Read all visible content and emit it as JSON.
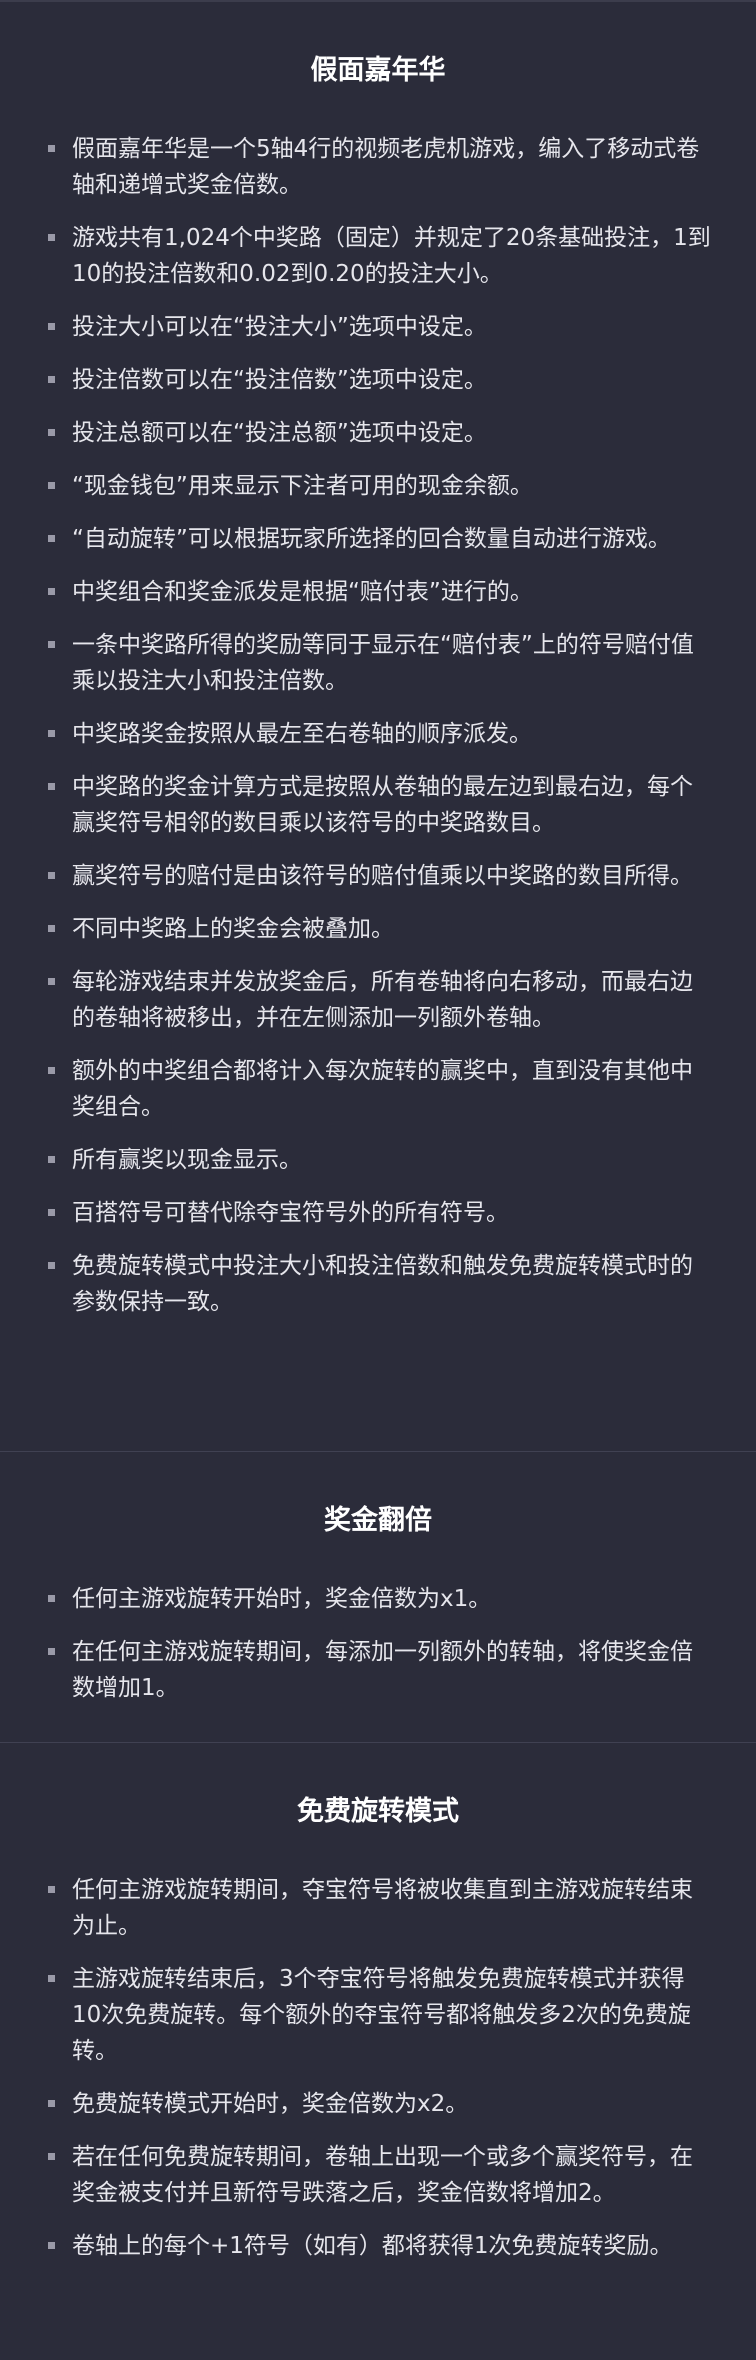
{
  "sections": [
    {
      "title": "假面嘉年华",
      "items": [
        "假面嘉年华是一个5轴4行的视频老虎机游戏，编入了移动式卷轴和递增式奖金倍数。",
        "游戏共有1,024个中奖路（固定）并规定了20条基础投注，1到10的投注倍数和0.02到0.20的投注大小。",
        "投注大小可以在“投注大小”选项中设定。",
        "投注倍数可以在“投注倍数”选项中设定。",
        "投注总额可以在“投注总额”选项中设定。",
        "“现金钱包”用来显示下注者可用的现金余额。",
        "“自动旋转”可以根据玩家所选择的回合数量自动进行游戏。",
        "中奖组合和奖金派发是根据“赔付表”进行的。",
        "一条中奖路所得的奖励等同于显示在“赔付表”上的符号赔付值乘以投注大小和投注倍数。",
        "中奖路奖金按照从最左至右卷轴的顺序派发。",
        "中奖路的奖金计算方式是按照从卷轴的最左边到最右边，每个赢奖符号相邻的数目乘以该符号的中奖路数目。",
        "赢奖符号的赔付是由该符号的赔付值乘以中奖路的数目所得。",
        "不同中奖路上的奖金会被叠加。",
        "每轮游戏结束并发放奖金后，所有卷轴将向右移动，而最右边的卷轴将被移出，并在左侧添加一列额外卷轴。",
        "额外的中奖组合都将计入每次旋转的赢奖中，直到没有其他中奖组合。",
        "所有赢奖以现金显示。",
        "百搭符号可替代除夺宝符号外的所有符号。",
        "免费旋转模式中投注大小和投注倍数和触发免费旋转模式时的参数保持一致。"
      ]
    },
    {
      "title": "奖金翻倍",
      "items": [
        "任何主游戏旋转开始时，奖金倍数为x1。",
        "在任何主游戏旋转期间，每添加一列额外的转轴，将使奖金倍数增加1。"
      ]
    },
    {
      "title": "免费旋转模式",
      "items": [
        "任何主游戏旋转期间，夺宝符号将被收集直到主游戏旋转结束为止。",
        "主游戏旋转结束后，3个夺宝符号将触发免费旋转模式并获得10次免费旋转。每个额外的夺宝符号都将触发多2次的免费旋转。",
        "免费旋转模式开始时，奖金倍数为x2。",
        "若在任何免费旋转期间，卷轴上出现一个或多个赢奖符号，在奖金被支付并且新符号跌落之后，奖金倍数将增加2。",
        "卷轴上的每个+1符号（如有）都将获得1次免费旋转奖励。"
      ]
    }
  ]
}
